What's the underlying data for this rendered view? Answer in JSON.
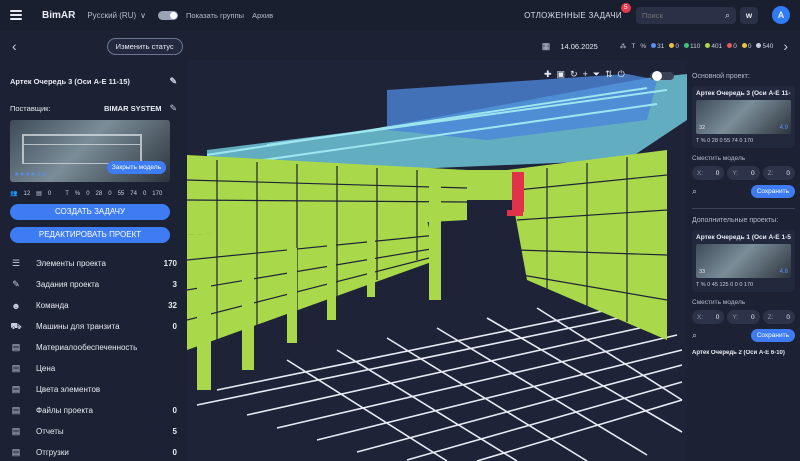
{
  "topbar": {
    "logo": "BimAR",
    "language": "Русский (RU)",
    "show_groups": "Показать группы",
    "archive": "Архив",
    "deferred_tasks": "ОТЛОЖЕННЫЕ ЗАДАЧИ",
    "deferred_count": "5",
    "search_placeholder": "Поиск",
    "w_label": "w",
    "avatar_letter": "A"
  },
  "subbar": {
    "change_status": "Изменить статус",
    "date": "14.06.2025",
    "t_label": "T",
    "percent": "%",
    "stats": [
      {
        "value": "31",
        "color": "#5a8ff0"
      },
      {
        "value": "0",
        "color": "#f0c23b"
      },
      {
        "value": "110",
        "color": "#3ec47a"
      },
      {
        "value": "401",
        "color": "#a9d94a"
      },
      {
        "value": "0",
        "color": "#e85b5b"
      },
      {
        "value": "0",
        "color": "#f0c23b"
      },
      {
        "value": "540",
        "color": "#c8cee0"
      }
    ]
  },
  "left": {
    "project_title": "Артек Очередь 3 (Оси А-Е 11-15)",
    "supplier_label": "Поставщик:",
    "supplier_value": "BIMAR SYSTEM",
    "thumb_score": "4.9",
    "close_model": "Закрыть модель",
    "thumb_users": "12",
    "thumb_docs": "0",
    "thumb_stats": [
      "T",
      "%",
      "0",
      "28",
      "0",
      "55",
      "74",
      "0",
      "170"
    ],
    "create_task": "СОЗДАТЬ ЗАДАЧУ",
    "edit_project": "РЕДАКТИРОВАТЬ ПРОЕКТ",
    "menu": [
      {
        "label": "Элементы проекта",
        "count": "170"
      },
      {
        "label": "Задания проекта",
        "count": "3"
      },
      {
        "label": "Команда",
        "count": "32"
      },
      {
        "label": "Машины для транзита",
        "count": "0"
      },
      {
        "label": "Материалообеспеченность",
        "count": ""
      },
      {
        "label": "Цена",
        "count": ""
      },
      {
        "label": "Цвета элементов",
        "count": ""
      },
      {
        "label": "Файлы проекта",
        "count": "0"
      },
      {
        "label": "Отчеты",
        "count": "5"
      },
      {
        "label": "Отгрузки",
        "count": "0"
      }
    ]
  },
  "right": {
    "main_project_label": "Основной проект:",
    "main_card_title": "Артек Очередь 3 (Оси А-Е 11-15)",
    "main_card_cnt": "32",
    "main_card_score": "4.9",
    "main_card_stats": "T % 0 28 0 55 74 0 170",
    "shift_label": "Сместить модель",
    "x": "0",
    "y": "0",
    "z": "0",
    "save": "Сохранить",
    "additional_label": "Дополнительные проекты:",
    "add_card_title": "Артек Очередь 1 (Оси А-Е 1-5)",
    "add_card_cnt": "33",
    "add_card_score": "4.8",
    "add_card_stats": "T % 0 45 125 0 0 0 170",
    "more_project": "Артек Очередь 2 (Оси А-Е 6-10)"
  }
}
